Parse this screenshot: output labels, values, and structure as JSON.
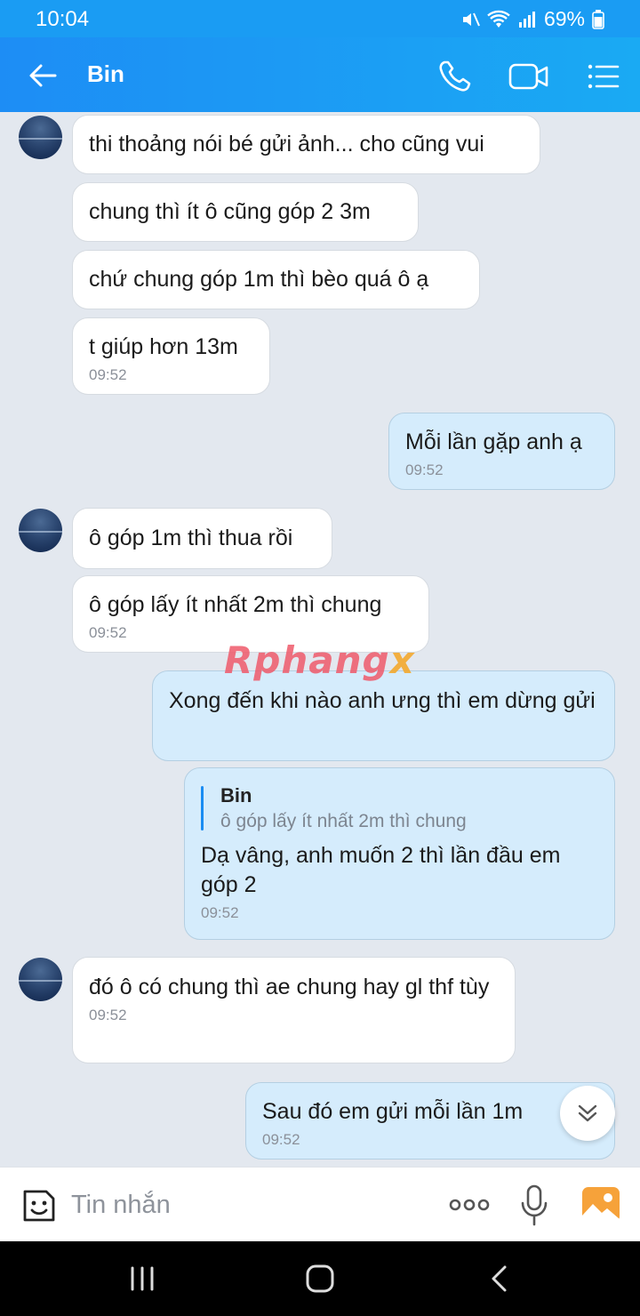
{
  "status_bar": {
    "time": "10:04",
    "battery": "69%"
  },
  "header": {
    "back_icon": "arrow-left-icon",
    "contact_name": "Bin",
    "call_icon": "phone-icon",
    "video_icon": "video-camera-icon",
    "menu_icon": "list-menu-icon",
    "gradient": [
      "#1d8df5",
      "#1aaaf3"
    ]
  },
  "messages": [
    {
      "side": "in",
      "text": "thi thoảng nói bé gửi ảnh... cho cũng vui"
    },
    {
      "side": "in",
      "text": "chung thì ít ô cũng góp 2 3m"
    },
    {
      "side": "in",
      "text": "chứ chung góp 1m thì bèo quá ô ạ"
    },
    {
      "side": "in",
      "text": "t giúp hơn 13m",
      "time": "09:52"
    },
    {
      "side": "out",
      "text": "Mỗi lần gặp anh ạ",
      "time": "09:52"
    },
    {
      "side": "in",
      "text": "ô góp 1m thì thua rồi"
    },
    {
      "side": "in",
      "text": "ô góp lấy ít nhất 2m thì chung",
      "time": "09:52"
    },
    {
      "side": "out",
      "text": "Xong đến khi nào anh ưng thì em dừng gửi"
    },
    {
      "side": "out",
      "quote_name": "Bin",
      "quote_text": "ô góp lấy ít nhất 2m thì chung",
      "text": "Dạ vâng, anh muốn 2 thì lần đầu em góp 2",
      "time": "09:52"
    },
    {
      "side": "in",
      "text": "đó ô có chung thì ae chung hay gl thf tùy",
      "time": "09:52"
    },
    {
      "side": "out",
      "text": "Sau đó em gửi mỗi lần 1m",
      "time": "09:52"
    }
  ],
  "watermark": {
    "main": "Rphang",
    "accent": "x"
  },
  "input_bar": {
    "placeholder": "Tin nhắn",
    "sticker_icon": "sticker-face-icon",
    "more_icon": "more-dots-icon",
    "mic_icon": "microphone-icon",
    "image_icon": "image-gallery-icon"
  },
  "nav_bar": {
    "recents_icon": "recents-icon",
    "home_icon": "home-icon",
    "back_icon": "nav-back-icon"
  },
  "colors": {
    "incoming_bubble": "#ffffff",
    "outgoing_bubble": "#d5ecfc",
    "chat_background": "#e3e8ef",
    "accent": "#1a8cf2"
  }
}
